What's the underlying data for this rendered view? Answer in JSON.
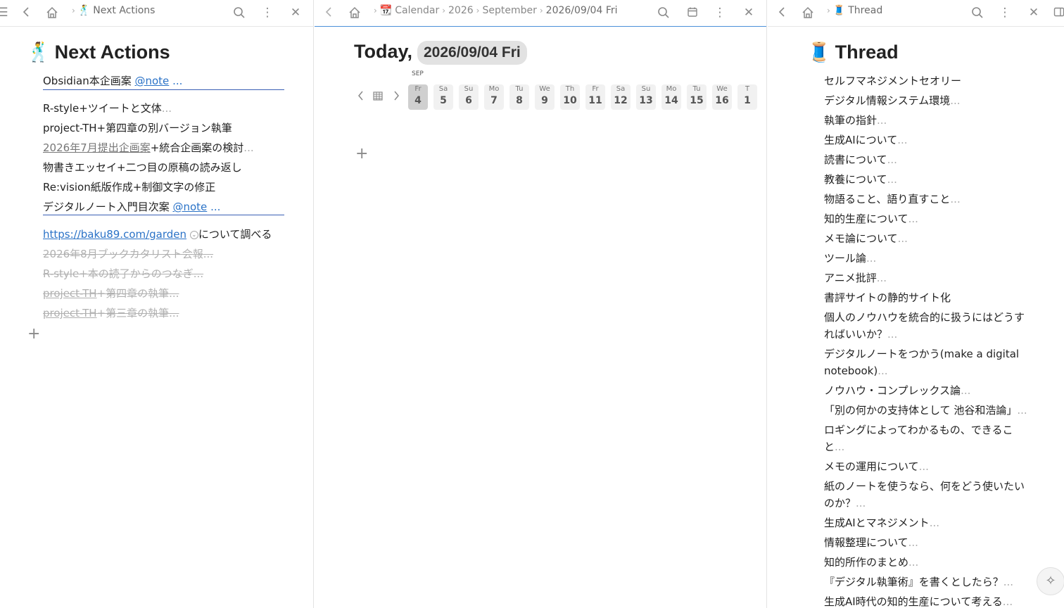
{
  "left_pane": {
    "breadcrumb_emoji": "🕺",
    "breadcrumb_title": "Next Actions",
    "title_emoji": "🕺",
    "title": "Next Actions",
    "items": [
      {
        "text": "Obsidian本企画案",
        "tag": "@note",
        "ellipsis": "..."
      },
      {
        "text": "R-style+ツイートと文体",
        "ellipsis": "..."
      },
      {
        "text": "project-TH+第四章の別バージョン執筆"
      },
      {
        "link": "2026年7月提出企画案",
        "text": "+統合企画案の検討",
        "ellipsis": "..."
      },
      {
        "text": "物書きエッセイ+二つ目の原稿の読み返し"
      },
      {
        "text": "Re:vision紙版作成+制御文字の修正"
      },
      {
        "text": "デジタルノート入門目次案",
        "tag": "@note",
        "ellipsis": "..."
      },
      {
        "link": "https://baku89.com/garden",
        "text": "について調べる"
      }
    ],
    "done_items": [
      {
        "text": "2026年8月ブックカタリスト会報",
        "ellipsis": "..."
      },
      {
        "text": "R-style+本の読了からのつなぎ",
        "ellipsis": "..."
      },
      {
        "link": "project-TH",
        "text": "+第四章の執筆",
        "ellipsis": "..."
      },
      {
        "link": "project-TH",
        "text": "+第三章の執筆",
        "ellipsis": "..."
      }
    ]
  },
  "middle_pane": {
    "breadcrumb": {
      "emoji": "📆",
      "calendar": "Calendar",
      "year": "2026",
      "month": "September",
      "current": "2026/09/04 Fri"
    },
    "today_label": "Today,",
    "date_badge": "2026/09/04 Fri",
    "month_label": "SEP",
    "days": [
      {
        "name": "Fr",
        "num": "4",
        "selected": true
      },
      {
        "name": "Sa",
        "num": "5"
      },
      {
        "name": "Su",
        "num": "6"
      },
      {
        "name": "Mo",
        "num": "7"
      },
      {
        "name": "Tu",
        "num": "8"
      },
      {
        "name": "We",
        "num": "9"
      },
      {
        "name": "Th",
        "num": "10"
      },
      {
        "name": "Fr",
        "num": "11"
      },
      {
        "name": "Sa",
        "num": "12"
      },
      {
        "name": "Su",
        "num": "13"
      },
      {
        "name": "Mo",
        "num": "14"
      },
      {
        "name": "Tu",
        "num": "15"
      },
      {
        "name": "We",
        "num": "16"
      },
      {
        "name": "T",
        "num": "1"
      }
    ]
  },
  "right_pane": {
    "breadcrumb_emoji": "🧵",
    "breadcrumb_title": "Thread",
    "title_emoji": "🧵",
    "title": "Thread",
    "items": [
      {
        "text": "セルフマネジメントセオリー"
      },
      {
        "text": "デジタル情報システム環境",
        "ellipsis": "..."
      },
      {
        "text": "執筆の指針",
        "ellipsis": "..."
      },
      {
        "text": "生成AIについて",
        "ellipsis": "..."
      },
      {
        "text": "読書について",
        "ellipsis": "..."
      },
      {
        "text": "教養について",
        "ellipsis": "..."
      },
      {
        "text": "物語ること、語り直すこと",
        "ellipsis": "..."
      },
      {
        "text": "知的生産について",
        "ellipsis": "..."
      },
      {
        "text": "メモ論について",
        "ellipsis": "..."
      },
      {
        "text": "ツール論",
        "ellipsis": "..."
      },
      {
        "text": "アニメ批評",
        "ellipsis": "..."
      },
      {
        "text": "書評サイトの静的サイト化"
      },
      {
        "text": "個人のノウハウを統合的に扱うにはどうす",
        "text2": "ればいいか？",
        "ellipsis": "..."
      },
      {
        "text": "デジタルノートをつかう(make a digital",
        "text2": "notebook)",
        "ellipsis": "..."
      },
      {
        "text": "ノウハウ・コンプレックス論",
        "ellipsis": "..."
      },
      {
        "text": "「別の何かの支持体として 池谷和浩論」",
        "ellipsis": "..."
      },
      {
        "text": "ロギングによってわかるもの、できるこ",
        "text2": "と",
        "ellipsis": "..."
      },
      {
        "text": "メモの運用について",
        "ellipsis": "..."
      },
      {
        "text": "紙のノートを使うなら、何をどう使いたい",
        "text2": "のか？",
        "ellipsis": "..."
      },
      {
        "text": "生成AIとマネジメント",
        "ellipsis": "..."
      },
      {
        "text": "情報整理について",
        "ellipsis": "..."
      },
      {
        "text": "知的所作のまとめ",
        "ellipsis": "..."
      },
      {
        "text": "『デジタル執筆術』を書くとしたら？",
        "ellipsis": "..."
      },
      {
        "text": "生成AI時代の知的生産について考える",
        "ellipsis": "..."
      }
    ]
  },
  "colors": {
    "link": "#2a72c7",
    "underline_bar": "#3a5fb4",
    "active_header_border": "#4a90d9",
    "done_text": "#b0b0b0"
  },
  "icons": [
    "menu-icon",
    "back-icon",
    "home-icon",
    "search-icon",
    "more-icon",
    "close-icon",
    "calendar-icon",
    "plus-icon",
    "ai-sparkle-icon"
  ]
}
